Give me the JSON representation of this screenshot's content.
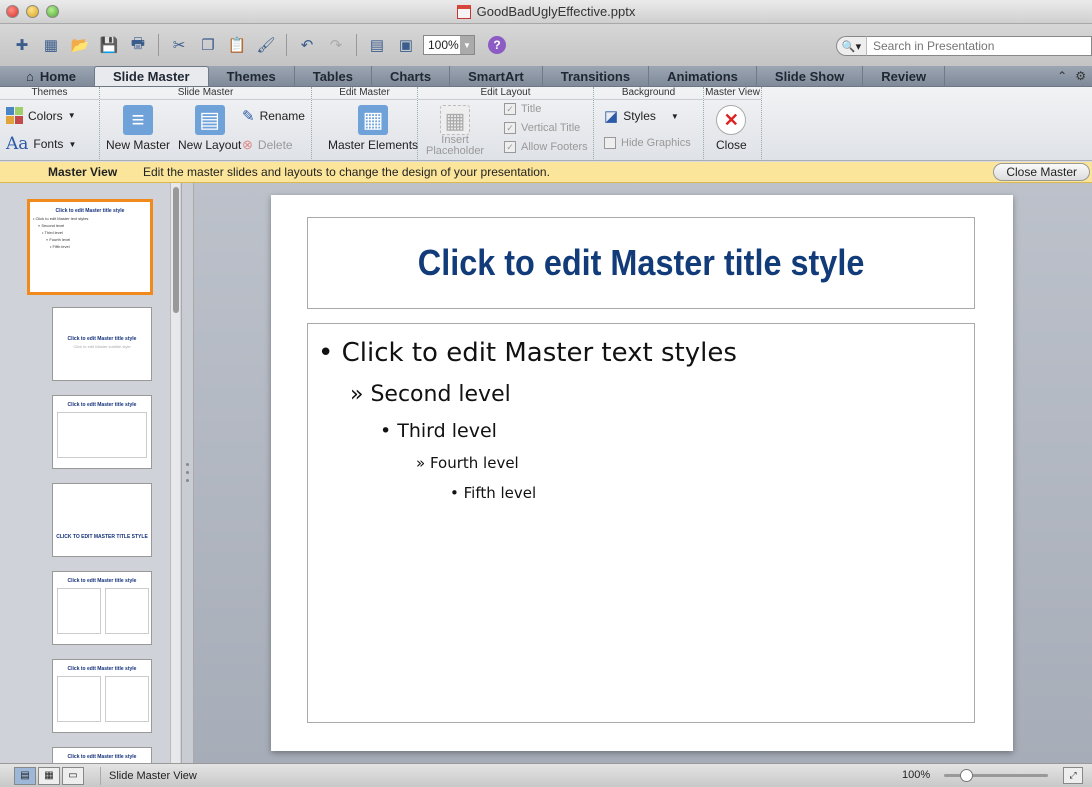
{
  "window": {
    "title": "GoodBadUglyEffective.pptx"
  },
  "toolbar": {
    "zoom": "100%",
    "search_placeholder": "Search in Presentation"
  },
  "tabs": [
    {
      "label": "Home"
    },
    {
      "label": "Slide Master"
    },
    {
      "label": "Themes"
    },
    {
      "label": "Tables"
    },
    {
      "label": "Charts"
    },
    {
      "label": "SmartArt"
    },
    {
      "label": "Transitions"
    },
    {
      "label": "Animations"
    },
    {
      "label": "Slide Show"
    },
    {
      "label": "Review"
    }
  ],
  "ribbon": {
    "groups": {
      "themes": "Themes",
      "slide_master": "Slide Master",
      "edit_master": "Edit Master",
      "edit_layout": "Edit Layout",
      "background": "Background",
      "master_view": "Master View"
    },
    "colors": "Colors",
    "fonts": "Fonts",
    "new_master": "New Master",
    "new_layout": "New Layout",
    "rename": "Rename",
    "delete": "Delete",
    "master_elements": "Master Elements",
    "insert_placeholder_1": "Insert",
    "insert_placeholder_2": "Placeholder",
    "title": "Title",
    "vertical_title": "Vertical Title",
    "allow_footers": "Allow Footers",
    "styles": "Styles",
    "hide_graphics": "Hide Graphics",
    "close": "Close"
  },
  "message_bar": {
    "label": "Master View",
    "text": "Edit the master slides and layouts to change the design of your presentation.",
    "button": "Close Master"
  },
  "thumbnails": {
    "t1_title": "Click to edit Master title style",
    "t1_l1": "• Click to edit Master text styles",
    "t1_l2": "» Second level",
    "t1_l3": "• Third level",
    "t1_l4": "» Fourth level",
    "t1_l5": "• Fifth level",
    "t2_title": "Click to edit Master title style",
    "t2_sub": "Click to edit Master subtitle style",
    "t3_title": "Click to edit Master title style",
    "t4_title": "CLICK TO EDIT MASTER TITLE STYLE",
    "t5_title": "Click to edit Master title style",
    "t6_title": "Click to edit Master title style",
    "t7_title": "Click to edit Master title style"
  },
  "slide": {
    "title": "Click to edit Master title style",
    "level1": "Click to edit Master text styles",
    "level2": "» Second level",
    "level3": "• Third level",
    "level4": "» Fourth level",
    "level5": "• Fifth level"
  },
  "status": {
    "label": "Slide Master View",
    "zoom": "100%"
  }
}
